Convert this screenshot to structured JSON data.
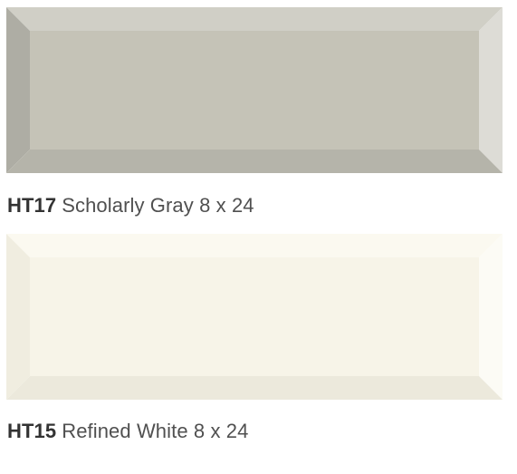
{
  "tiles": [
    {
      "code": "HT17",
      "name": "Scholarly Gray 8 x 24",
      "colors": {
        "face": "#c5c3b7",
        "bevel_top": "#d0cfc6",
        "bevel_left": "#aeada4",
        "bevel_right": "#dddcd6",
        "bevel_bottom": "#b5b4aa",
        "edge": "#a9a89f"
      }
    },
    {
      "code": "HT15",
      "name": "Refined White 8 x 24",
      "colors": {
        "face": "#f7f4e8",
        "bevel_top": "#fbf9f0",
        "bevel_left": "#f0ede0",
        "bevel_right": "#fcfbf5",
        "bevel_bottom": "#ece9dc",
        "edge": "#ebe8db"
      }
    }
  ]
}
